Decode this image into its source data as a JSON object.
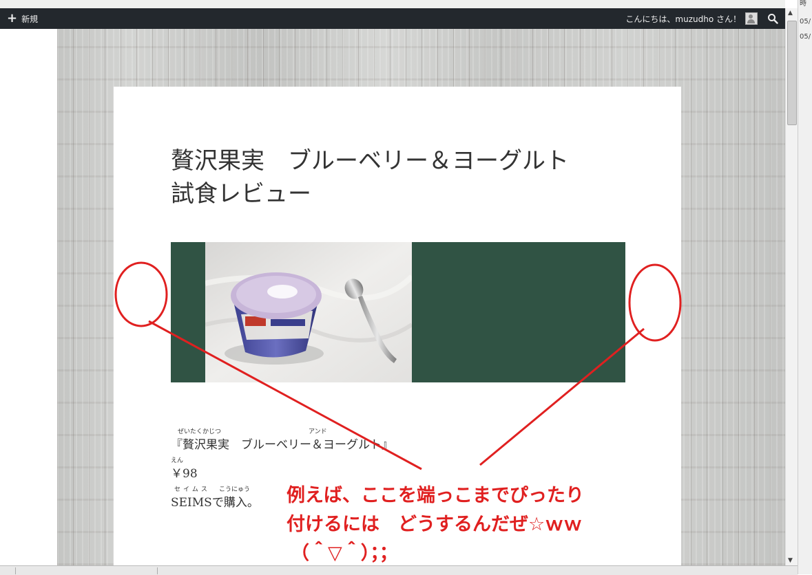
{
  "adminbar": {
    "new_label": "新規",
    "greeting": "こんにちは、muzudho さん！",
    "icons": [
      "plus-icon",
      "avatar-icon",
      "search-icon"
    ]
  },
  "right_panel": {
    "lines": [
      "時",
      "05/",
      "05/"
    ]
  },
  "post": {
    "title_line1": "贅沢果実　ブルーベリー＆ヨーグルト",
    "title_line2": "試食レビュー",
    "content": {
      "ruby1_a": "ぜいたくかじつ",
      "ruby1_b": "アンド",
      "line1": "『贅沢果実　ブルーベリー＆ヨーグルト』",
      "ruby2": "えん",
      "line2": "￥98",
      "ruby3_a": "セイムス",
      "ruby3_b": "こうにゅう",
      "line3": "SEIMSで購入。"
    }
  },
  "annotation": {
    "line1": "例えば、ここを端っこまでぴったり",
    "line2": "付けるには　どうするんだぜ☆ｗｗ",
    "line3": "（＾▽＾）；；",
    "color": "#e02020"
  },
  "colors": {
    "adminbar": "#23282d",
    "image_background": "#305344"
  }
}
